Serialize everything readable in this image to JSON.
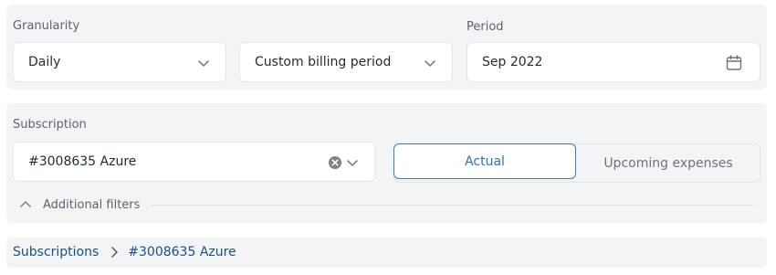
{
  "filters": {
    "granularity": {
      "label": "Granularity",
      "value": "Daily"
    },
    "billing_period_type": {
      "value": "Custom billing period"
    },
    "period": {
      "label": "Period",
      "value": "Sep 2022"
    }
  },
  "subscription": {
    "label": "Subscription",
    "value": "#3008635 Azure"
  },
  "view_toggle": {
    "options": [
      "Actual",
      "Upcoming expenses"
    ],
    "selected": "Actual"
  },
  "additional_filters": {
    "label": "Additional filters"
  },
  "breadcrumb": {
    "items": [
      "Subscriptions",
      "#3008635 Azure"
    ]
  },
  "colors": {
    "accent": "#3b7bbf",
    "link": "#1d4e89",
    "panel_bg": "#f3f4f6"
  },
  "icons": [
    "chevron-down-icon",
    "calendar-icon",
    "clear-icon",
    "chevron-up-icon",
    "chevron-right-icon"
  ]
}
